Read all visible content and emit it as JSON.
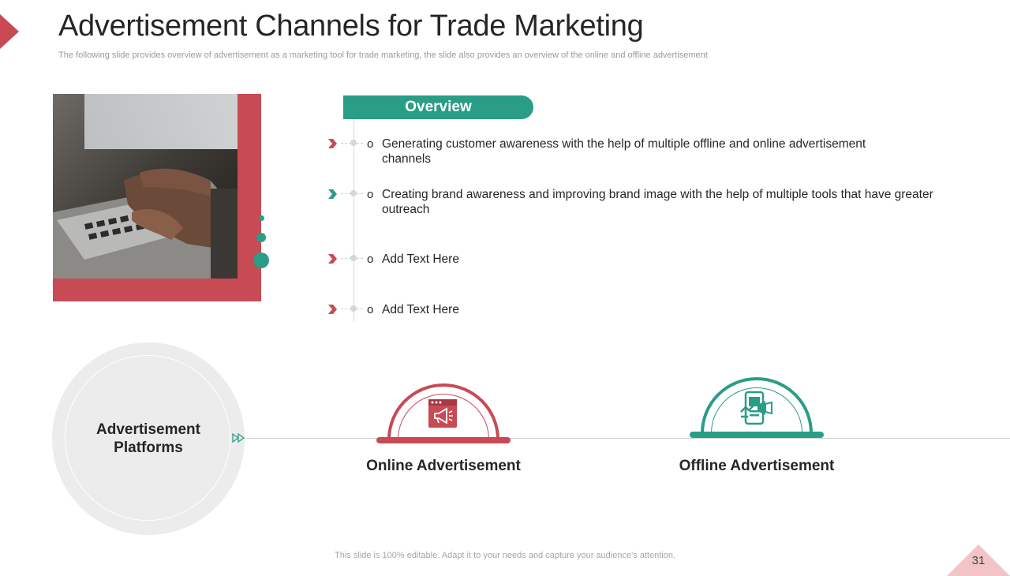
{
  "slide": {
    "title": "Advertisement Channels for Trade Marketing",
    "subtitle": "The following slide provides overview of advertisement as a marketing tool for trade marketing, the slide also provides an overview of the online and offline advertisement",
    "page_number": "31",
    "footer_note": "This slide is 100% editable. Adapt it to your needs and capture your audience's attention."
  },
  "overview": {
    "heading": "Overview",
    "bullet_marker": "o",
    "points": [
      {
        "text": "Generating customer awareness with the help of multiple offline and online advertisement channels",
        "chevron_color": "#c74a55"
      },
      {
        "text": "Creating brand awareness and improving brand image with the help of multiple tools that have greater outreach",
        "chevron_color": "#2a9d87"
      },
      {
        "text": "Add Text Here",
        "chevron_color": "#c74a55"
      },
      {
        "text": "Add Text Here",
        "chevron_color": "#c74a55"
      }
    ]
  },
  "platforms": {
    "center_label": "Advertisement Platforms",
    "channels": [
      {
        "label": "Online Advertisement",
        "color": "#c74a55",
        "icon": "megaphone-browser-icon"
      },
      {
        "label": "Offline Advertisement",
        "color": "#2a9d87",
        "icon": "billboard-megaphone-icon"
      }
    ]
  },
  "colors": {
    "accent_red": "#c74a55",
    "accent_teal": "#2a9d87",
    "light_gray": "#ececec",
    "page_tab": "#f2c4c8"
  }
}
